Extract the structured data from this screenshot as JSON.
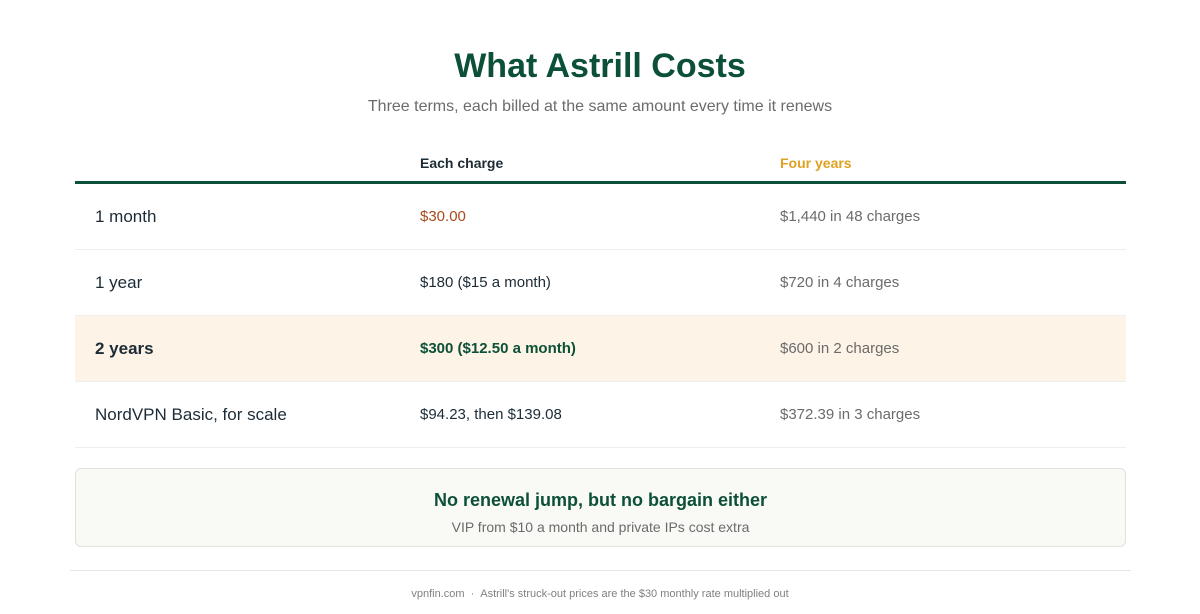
{
  "header": {
    "title": "What Astrill Costs",
    "subtitle": "Three terms, each billed at the same amount every time it renews"
  },
  "table": {
    "columns": [
      "",
      "Each charge",
      "Four years"
    ],
    "rows": [
      {
        "plan": "1 month",
        "each_charge": "$30.00",
        "four_years": "$1,440 in 48 charges"
      },
      {
        "plan": "1 year",
        "each_charge": "$180 ($15 a month)",
        "four_years": "$720 in 4 charges"
      },
      {
        "plan": "2 years",
        "each_charge": "$300 ($12.50 a month)",
        "four_years": "$600 in 2 charges"
      },
      {
        "plan": "NordVPN Basic, for scale",
        "each_charge": "$94.23, then $139.08",
        "four_years": "$372.39 in 3 charges"
      }
    ],
    "highlighted_row": "2 years"
  },
  "callout": {
    "title": "No renewal jump, but no bargain either",
    "subtitle": "VIP from $10 a month and private IPs cost extra"
  },
  "footer": {
    "site": "vpnfin.com",
    "separator": "·",
    "note": "Astrill's struck-out prices are the $30 monthly rate multiplied out"
  },
  "colors": {
    "brand_green": "#0d5038",
    "accent_gold": "#e0a020",
    "warn_rust": "#a64b1c",
    "highlight_bg": "#fdf3e6"
  }
}
